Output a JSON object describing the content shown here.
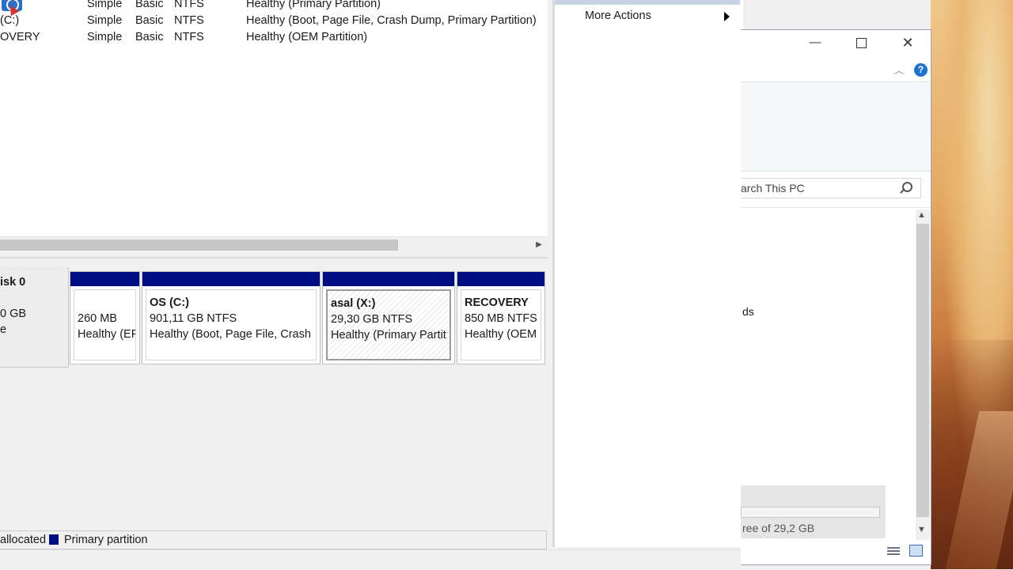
{
  "volume_list": {
    "rows": [
      {
        "name": "",
        "layout": "Simple",
        "type": "Basic",
        "fs": "NTFS",
        "status": "Healthy (Primary Partition)"
      },
      {
        "name": "(C:)",
        "layout": "Simple",
        "type": "Basic",
        "fs": "NTFS",
        "status": "Healthy (Boot, Page File, Crash Dump, Primary Partition)"
      },
      {
        "name": "OVERY",
        "layout": "Simple",
        "type": "Basic",
        "fs": "NTFS",
        "status": "Healthy (OEM Partition)"
      }
    ]
  },
  "disk": {
    "name": "isk 0",
    "size": "0 GB",
    "state": "e"
  },
  "partitions": [
    {
      "label": "",
      "size": "260 MB",
      "status": "Healthy (EF"
    },
    {
      "label": "OS  (C:)",
      "size": "901,11 GB NTFS",
      "status": "Healthy (Boot, Page File, Crash"
    },
    {
      "label": "asal  (X:)",
      "size": "29,30 GB NTFS",
      "status": "Healthy (Primary Partit"
    },
    {
      "label": "RECOVERY",
      "size": "850 MB NTFS",
      "status": "Healthy (OEM"
    }
  ],
  "legend": {
    "unallocated": "allocated",
    "primary": "Primary partition",
    "primary_color": "#010d82"
  },
  "actions": {
    "more_actions": "More Actions"
  },
  "explorer": {
    "search_placeholder": "arch This PC",
    "nav_partial": "ds",
    "drive_free": "ree of 29,2 GB",
    "help": "?",
    "icons": [
      "minimize-icon",
      "maximize-icon",
      "close-icon",
      "help-icon",
      "search-icon",
      "details-view-icon",
      "large-icons-view-icon"
    ]
  }
}
